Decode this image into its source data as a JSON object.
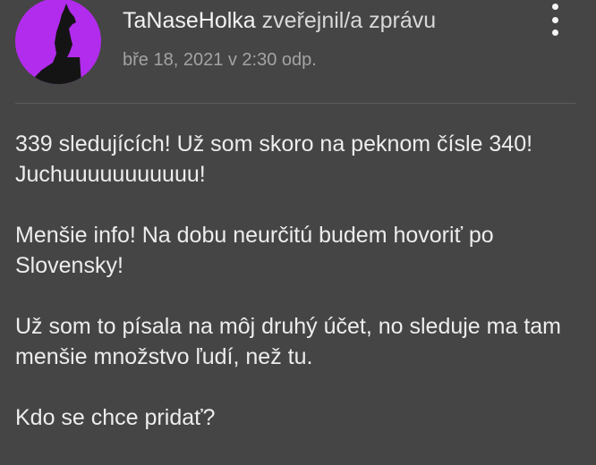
{
  "post": {
    "author": "TaNaseHolka",
    "action": " zveřejnil/a zprávu",
    "timestamp": "bře 18, 2021 v 2:30 odp.",
    "paragraphs": [
      "339 sledujících! Už som skoro na peknom čísle 340! Juchuuuuuuuuuuu!",
      "Menšie info! Na dobu neurčitú budem hovoriť po Slovensky!",
      "Už som to písala na môj druhý účet, no sleduje ma tam menšie množstvo ľudí, než tu.",
      "Kdo se chce pridať?"
    ]
  },
  "icons": {
    "avatar": "wolf-howling-avatar",
    "menu": "more-vertical-icon"
  },
  "colors": {
    "background": "#454545",
    "avatar_bg": "#b12cec",
    "text": "#ededed",
    "muted": "#a3a3a3"
  }
}
